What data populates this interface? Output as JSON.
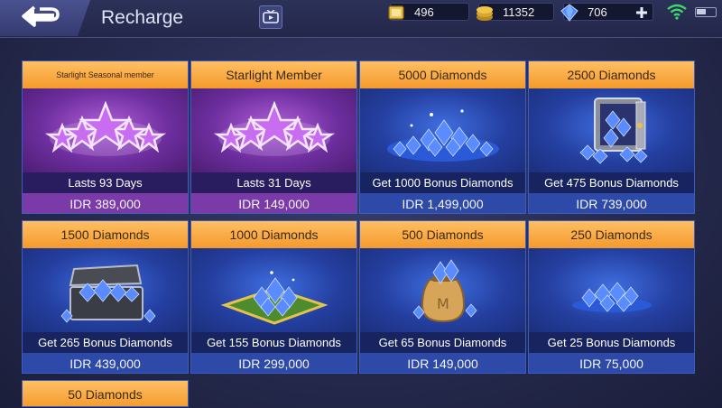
{
  "header": {
    "title": "Recharge",
    "back_icon": "back-arrow-icon",
    "tv_icon": "tv-icon"
  },
  "currencies": [
    {
      "name": "tickets",
      "icon": "ticket-icon",
      "value": "496",
      "color": "#e8c14a"
    },
    {
      "name": "battle-points",
      "icon": "coin-icon",
      "value": "11352",
      "color": "#e0b23a"
    },
    {
      "name": "diamonds",
      "icon": "diamond-icon",
      "value": "706",
      "color": "#4f8cff"
    }
  ],
  "status": {
    "wifi_icon": "wifi-icon",
    "battery_icon": "battery-icon",
    "add_icon": "plus-icon"
  },
  "colors": {
    "header_orange": "#f49a2c",
    "diamond_blue": "#4f8cff",
    "member_purple": "#7a3ba8"
  },
  "packages": [
    {
      "title": "Starlight Seasonal member",
      "subtitle": "Lasts 93 Days",
      "price": "IDR 389,000",
      "image": "starlight-stars-icon",
      "type": "member"
    },
    {
      "title": "Starlight Member",
      "subtitle": "Lasts 31 Days",
      "price": "IDR 149,000",
      "image": "starlight-stars-icon",
      "type": "member"
    },
    {
      "title": "5000 Diamonds",
      "subtitle": "Get 1000 Bonus Diamonds",
      "price": "IDR 1,499,000",
      "image": "diamond-pile-icon",
      "type": "diamond"
    },
    {
      "title": "2500 Diamonds",
      "subtitle": "Get 475 Bonus Diamonds",
      "price": "IDR 739,000",
      "image": "diamond-safe-icon",
      "type": "diamond"
    },
    {
      "title": "1500 Diamonds",
      "subtitle": "Get 265 Bonus Diamonds",
      "price": "IDR 439,000",
      "image": "diamond-chest-icon",
      "type": "diamond"
    },
    {
      "title": "1000 Diamonds",
      "subtitle": "Get 155 Bonus Diamonds",
      "price": "IDR 299,000",
      "image": "diamond-cushion-icon",
      "type": "diamond"
    },
    {
      "title": "500 Diamonds",
      "subtitle": "Get 65 Bonus Diamonds",
      "price": "IDR 149,000",
      "image": "diamond-bag-icon",
      "type": "diamond"
    },
    {
      "title": "250 Diamonds",
      "subtitle": "Get 25 Bonus Diamonds",
      "price": "IDR 75,000",
      "image": "diamond-small-pile-icon",
      "type": "diamond"
    },
    {
      "title": "50 Diamonds",
      "subtitle": "",
      "price": "",
      "image": "",
      "type": "diamond"
    }
  ]
}
